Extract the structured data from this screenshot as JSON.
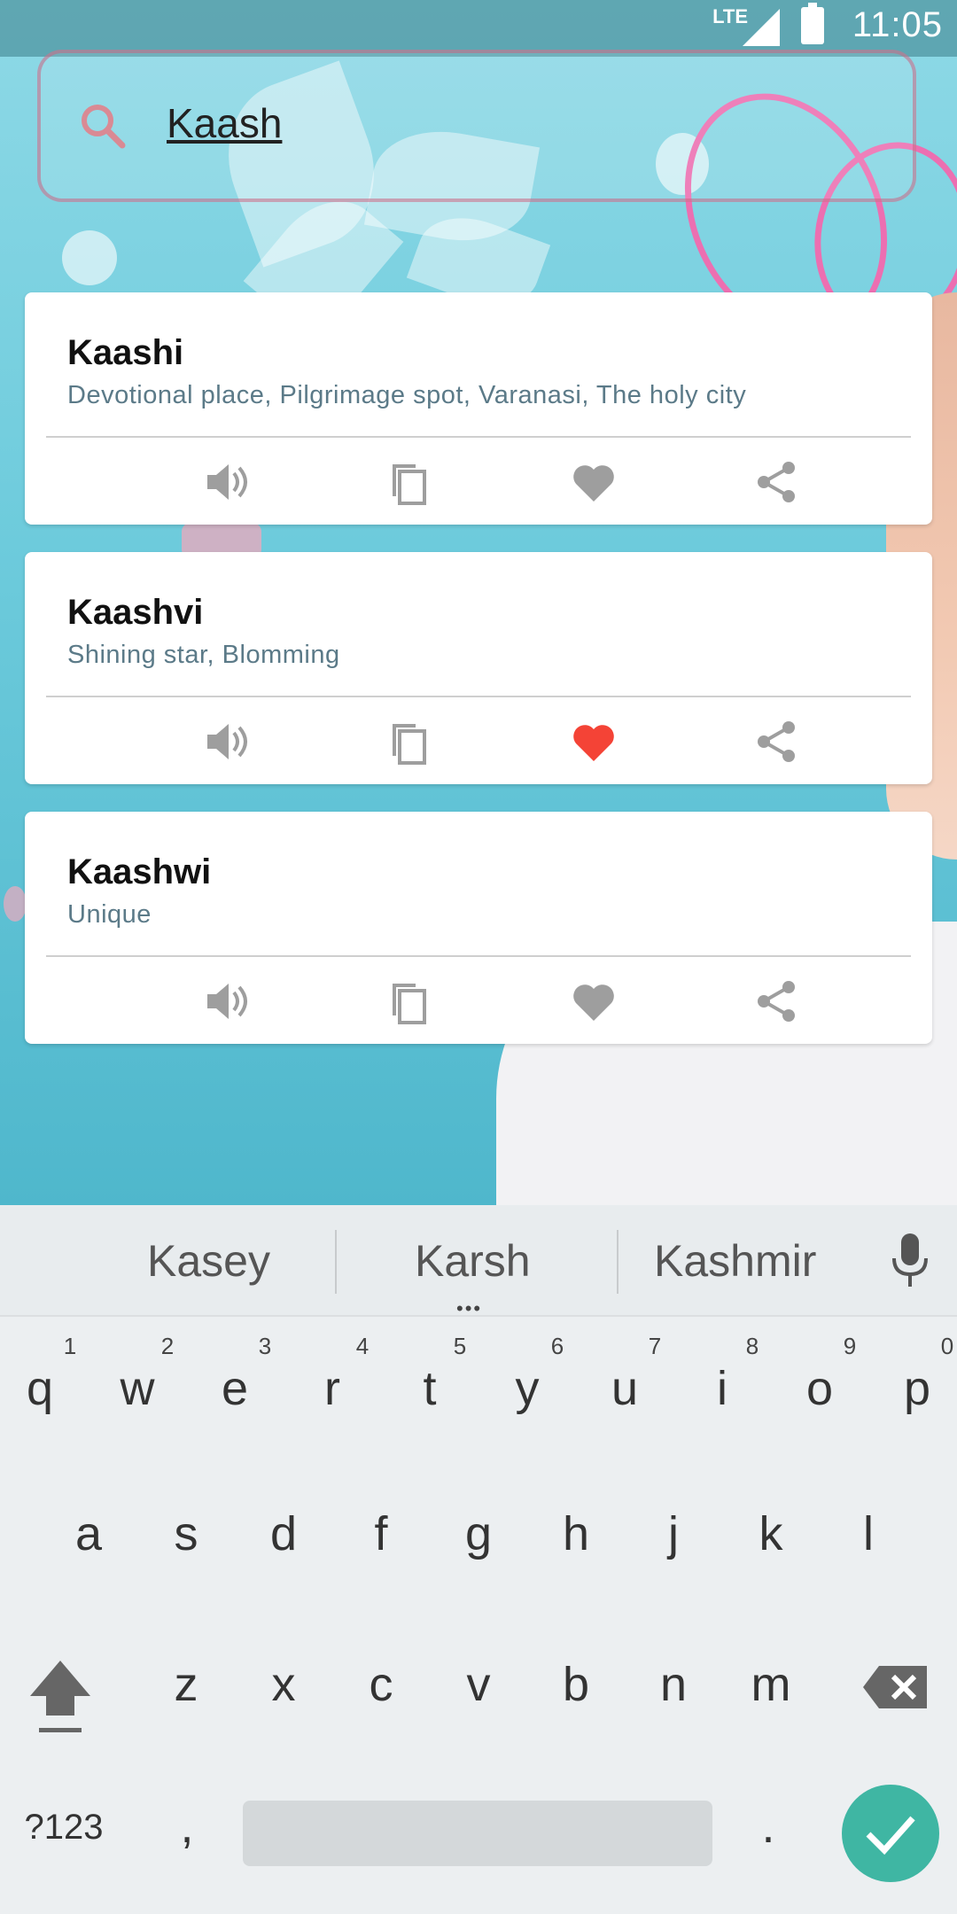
{
  "status_bar": {
    "network": "LTE",
    "time": "11:05"
  },
  "search": {
    "query": "Kaash",
    "icon": "search-icon"
  },
  "results": [
    {
      "name": "Kaashi",
      "meaning": "Devotional place, Pilgrimage spot, Varanasi, The holy city",
      "favorite": false
    },
    {
      "name": "Kaashvi",
      "meaning": "Shining star, Blomming",
      "favorite": true
    },
    {
      "name": "Kaashwi",
      "meaning": "Unique",
      "favorite": false
    }
  ],
  "action_icons": [
    "speaker-icon",
    "copy-icon",
    "heart-icon",
    "share-icon"
  ],
  "colors": {
    "favorite_active": "#f44336",
    "favorite_inactive": "#9e9e9e",
    "accent": "#3fb6a3"
  },
  "keyboard": {
    "suggestions": [
      "Kasey",
      "Karsh",
      "Kashmir"
    ],
    "row1": [
      "q",
      "w",
      "e",
      "r",
      "t",
      "y",
      "u",
      "i",
      "o",
      "p"
    ],
    "row1_hints": [
      "1",
      "2",
      "3",
      "4",
      "5",
      "6",
      "7",
      "8",
      "9",
      "0"
    ],
    "row2": [
      "a",
      "s",
      "d",
      "f",
      "g",
      "h",
      "j",
      "k",
      "l"
    ],
    "row3": [
      "z",
      "x",
      "c",
      "v",
      "b",
      "n",
      "m"
    ],
    "symbols_label": "?123",
    "comma": ",",
    "period": "."
  }
}
